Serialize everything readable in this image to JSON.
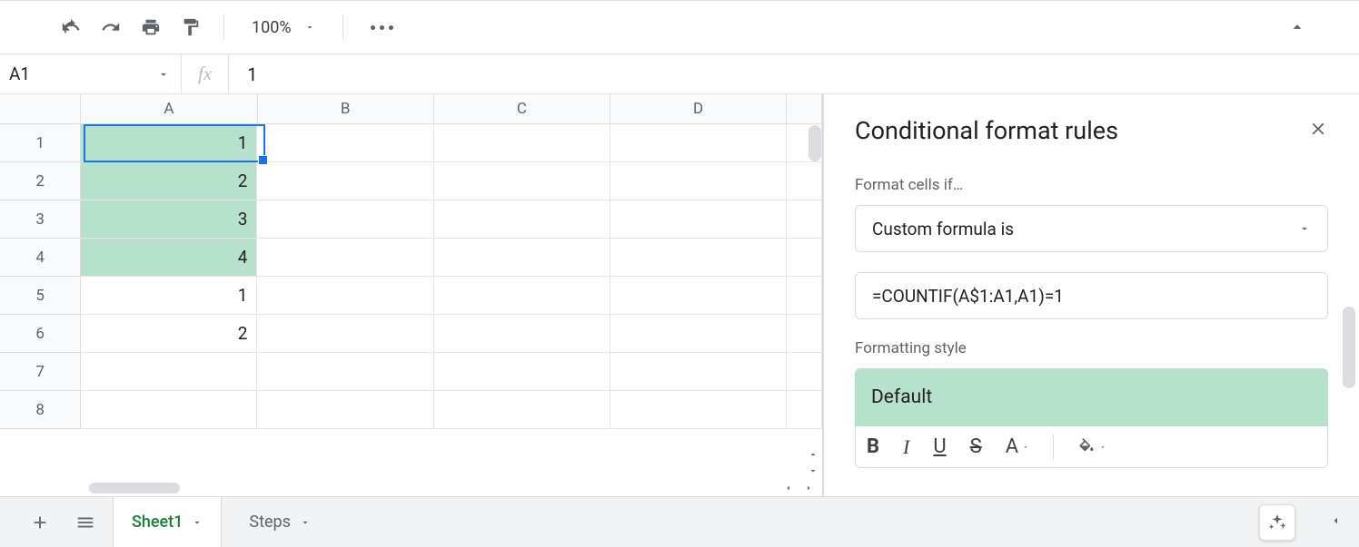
{
  "toolbar": {
    "zoom": "100%"
  },
  "namebox": "A1",
  "fx_label": "fx",
  "formula": "1",
  "columns": [
    "A",
    "B",
    "C",
    "D"
  ],
  "rows": [
    "1",
    "2",
    "3",
    "4",
    "5",
    "6",
    "7",
    "8"
  ],
  "cells": {
    "A1": "1",
    "A2": "2",
    "A3": "3",
    "A4": "4",
    "A5": "1",
    "A6": "2"
  },
  "highlighted": [
    "A1",
    "A2",
    "A3",
    "A4"
  ],
  "panel": {
    "title": "Conditional format rules",
    "label_if": "Format cells if…",
    "condition": "Custom formula is",
    "formula": "=COUNTIF(A$1:A1,A1)=1",
    "label_style": "Formatting style",
    "style_name": "Default"
  },
  "tabs": {
    "active": "Sheet1",
    "other": "Steps"
  }
}
